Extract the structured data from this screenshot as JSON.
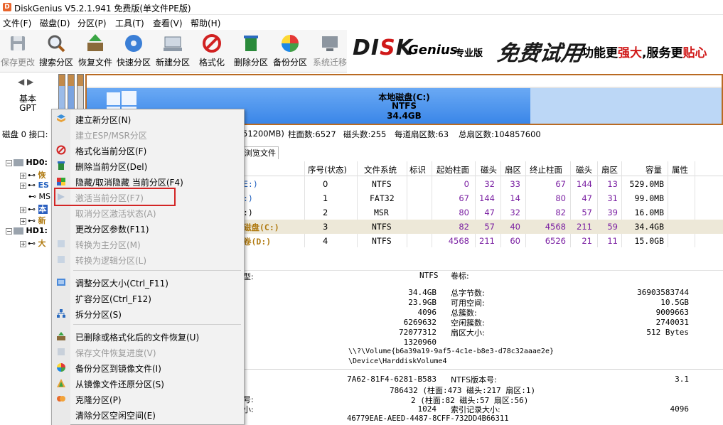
{
  "window": {
    "title": "DiskGenius V5.2.1.941 免费版(单文件PE版)",
    "icon_letter": "D"
  },
  "menu": [
    "文件(F)",
    "磁盘(D)",
    "分区(P)",
    "工具(T)",
    "查看(V)",
    "帮助(H)"
  ],
  "toolbar": {
    "buttons": [
      {
        "label": "保存更改",
        "icon": "save-icon",
        "disabled": true
      },
      {
        "label": "搜索分区",
        "icon": "search-icon"
      },
      {
        "label": "恢复文件",
        "icon": "recover-icon"
      },
      {
        "label": "快速分区",
        "icon": "disk-icon"
      },
      {
        "label": "新建分区",
        "icon": "new-partition-icon"
      },
      {
        "label": "格式化",
        "icon": "format-icon"
      },
      {
        "label": "删除分区",
        "icon": "delete-icon"
      },
      {
        "label": "备份分区",
        "icon": "backup-icon"
      },
      {
        "label": "系统迁移",
        "icon": "migrate-icon",
        "disabled": true
      }
    ]
  },
  "banner": {
    "brand_a": "DI",
    "brand_b": "S",
    "brand_c": "K",
    "brand_name": "Genius",
    "edition": "专业版",
    "trial": "免费试用",
    "slogan_a": "功能更",
    "slogan_b": "强大",
    "slogan_c": ",服务更",
    "slogan_d": "贴心"
  },
  "disk_strip": {
    "nav": "◀ ▶",
    "type_line1": "基本",
    "type_line2": "GPT",
    "partition_name": "本地磁盘(C:)",
    "partition_fs": "NTFS",
    "partition_size": "34.4GB"
  },
  "disk_info": {
    "prefix": "磁盘 0 接口:",
    "capacity_tail": "51200MB)",
    "cylinders": "柱面数:6527",
    "heads": "磁头数:255",
    "sectors_per_track": "每道扇区数:63",
    "total_sectors": "总扇区数:104857600"
  },
  "tree": {
    "hd0": "HD0:",
    "hd1": "HD1:",
    "items": [
      "恢",
      "ES",
      "MS",
      "本",
      "新",
      "大"
    ]
  },
  "tabs": {
    "browse": "浏览文件"
  },
  "table": {
    "headers": [
      "序号(状态)",
      "文件系统",
      "标识",
      "起始柱面",
      "磁头",
      "扇区",
      "终止柱面",
      "磁头",
      "扇区",
      "容量",
      "属性"
    ],
    "rows": [
      {
        "name": "E:)",
        "idx": "0",
        "fs": "NTFS",
        "c1": "0",
        "h1": "32",
        "s1": "33",
        "c2": "67",
        "h2": "144",
        "s2": "13",
        "size": "529.0MB"
      },
      {
        "name": ":)",
        "idx": "1",
        "fs": "FAT32",
        "c1": "67",
        "h1": "144",
        "s1": "14",
        "c2": "80",
        "h2": "47",
        "s2": "31",
        "size": "99.0MB"
      },
      {
        "name": ":)",
        "idx": "2",
        "fs": "MSR",
        "c1": "80",
        "h1": "47",
        "s1": "32",
        "c2": "82",
        "h2": "57",
        "s2": "39",
        "size": "16.0MB"
      },
      {
        "name": "磁盘(C:)",
        "idx": "3",
        "fs": "NTFS",
        "c1": "82",
        "h1": "57",
        "s1": "40",
        "c2": "4568",
        "h2": "211",
        "s2": "59",
        "size": "34.4GB"
      },
      {
        "name": "卷(D:)",
        "idx": "4",
        "fs": "NTFS",
        "c1": "4568",
        "h1": "211",
        "s1": "60",
        "c2": "6526",
        "h2": "21",
        "s2": "11",
        "size": "15.0GB"
      }
    ]
  },
  "details": {
    "type_label_tail": "型:",
    "fs_value": "NTFS",
    "volume_label": "卷标:",
    "values_left": [
      "34.4GB",
      "23.9GB",
      "4096",
      "6269632",
      "72077312",
      "1320960"
    ],
    "labels_right": [
      "总字节数:",
      "可用空间:",
      "总簇数:",
      "空闲簇数:",
      "扇区大小:"
    ],
    "values_right": [
      "36903583744",
      "10.5GB",
      "9009663",
      "2740031",
      "512 Bytes"
    ],
    "volume_path": "\\\\?\\Volume{b6a39a19-9af5-4c1e-b8e3-d78c32aaae2e}",
    "device_path": "\\Device\\HarddiskVolume4",
    "serial": "7A62-81F4-6281-B583",
    "ntfs_version_label": "NTFS版本号:",
    "ntfs_version": "3.1",
    "mft_pos": "786432 (柱面:473 磁头:217 扇区:1)",
    "mftmirr_label_tail": "号:",
    "mftmirr_pos": "2 (柱面:82 磁头:57 扇区:56)",
    "record_size_label_tail": "小:",
    "record_size": "1024",
    "index_size_label": "索引记录大小:",
    "index_size": "4096",
    "guid": "46779EAE-AEED-4487-8CFF-732DD4B66311"
  },
  "context_menu": {
    "items": [
      {
        "label": "建立新分区(N)",
        "icon": "new-partition-icon",
        "disabled": false
      },
      {
        "label": "建立ESP/MSR分区",
        "icon": "",
        "disabled": true
      },
      {
        "label": "格式化当前分区(F)",
        "icon": "format-icon",
        "disabled": false
      },
      {
        "label": "删除当前分区(Del)",
        "icon": "delete-icon",
        "disabled": false
      },
      {
        "label": "隐藏/取消隐藏 当前分区(F4)",
        "icon": "hide-icon",
        "disabled": false
      },
      {
        "label": "激活当前分区(F7)",
        "icon": "activate-icon",
        "disabled": true
      },
      {
        "label": "取消分区激活状态(A)",
        "icon": "",
        "disabled": true
      },
      {
        "label": "更改分区参数(F11)",
        "icon": "",
        "disabled": false
      },
      {
        "label": "转换为主分区(M)",
        "icon": "convert-icon",
        "disabled": true
      },
      {
        "label": "转换为逻辑分区(L)",
        "icon": "convert-icon",
        "disabled": true
      },
      {
        "label": "调整分区大小(Ctrl_F11)",
        "icon": "resize-icon",
        "disabled": false
      },
      {
        "label": "扩容分区(Ctrl_F12)",
        "icon": "",
        "disabled": false
      },
      {
        "label": "拆分分区(S)",
        "icon": "split-icon",
        "disabled": false
      },
      {
        "label": "已删除或格式化后的文件恢复(U)",
        "icon": "recover-icon",
        "disabled": false
      },
      {
        "label": "保存文件恢复进度(V)",
        "icon": "save-icon",
        "disabled": true
      },
      {
        "label": "备份分区到镜像文件(I)",
        "icon": "backup-icon",
        "disabled": false
      },
      {
        "label": "从镜像文件还原分区(S)",
        "icon": "restore-icon",
        "disabled": false
      },
      {
        "label": "克隆分区(P)",
        "icon": "clone-icon",
        "disabled": false
      },
      {
        "label": "清除分区空闲空间(E)",
        "icon": "",
        "disabled": false
      }
    ]
  },
  "colors": {
    "accent_red": "#d32525",
    "partition_blue": "#3a86e8",
    "partition_border": "#b96a22"
  }
}
